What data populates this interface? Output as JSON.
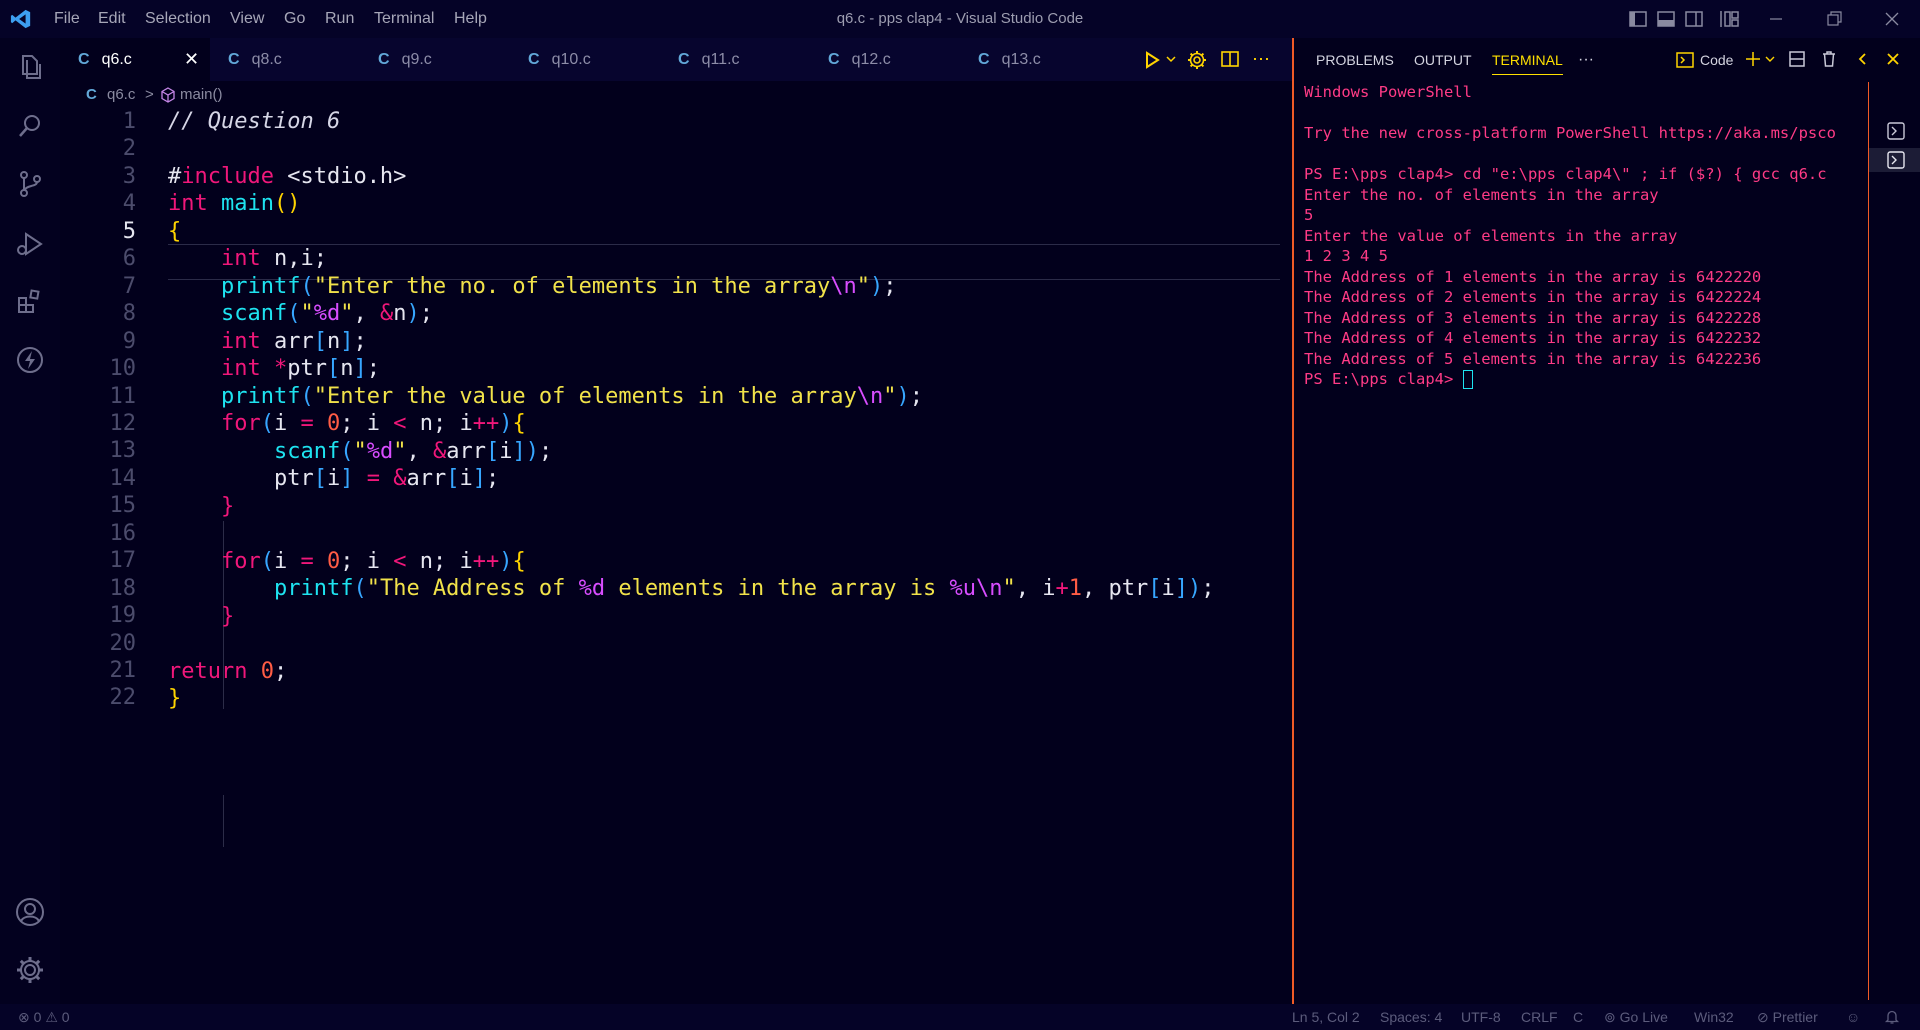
{
  "titlebar": {
    "window_title": "q6.c - pps clap4 - Visual Studio Code",
    "menu": [
      "File",
      "Edit",
      "Selection",
      "View",
      "Go",
      "Run",
      "Terminal",
      "Help"
    ]
  },
  "tabs": [
    {
      "label": "q6.c",
      "active": true
    },
    {
      "label": "q8.c"
    },
    {
      "label": "q9.c"
    },
    {
      "label": "q10.c"
    },
    {
      "label": "q11.c"
    },
    {
      "label": "q12.c"
    },
    {
      "label": "q13.c"
    }
  ],
  "tab_letter": "C",
  "breadcrumb": {
    "file": "q6.c",
    "separator": ">",
    "symbol": "main()"
  },
  "editor": {
    "current_line": 5,
    "line_numbers": [
      "1",
      "2",
      "3",
      "4",
      "5",
      "6",
      "7",
      "8",
      "9",
      "10",
      "11",
      "12",
      "13",
      "14",
      "15",
      "16",
      "17",
      "18",
      "19",
      "20",
      "21",
      "22"
    ]
  },
  "panel": {
    "tabs": [
      "PROBLEMS",
      "OUTPUT",
      "TERMINAL"
    ],
    "active_tab": "TERMINAL",
    "more": "···",
    "terminal_profile": "Code",
    "terminal_lines": [
      "Windows PowerShell",
      "",
      "Try the new cross-platform PowerShell https://aka.ms/psco",
      "",
      "PS E:\\pps clap4> cd \"e:\\pps clap4\\\" ; if ($?) { gcc q6.c",
      "Enter the no. of elements in the array",
      "5",
      "Enter the value of elements in the array",
      "1 2 3 4 5",
      "The Address of 1 elements in the array is 6422220",
      "The Address of 2 elements in the array is 6422224",
      "The Address of 3 elements in the array is 6422228",
      "The Address of 4 elements in the array is 6422232",
      "The Address of 5 elements in the array is 6422236",
      "PS E:\\pps clap4> "
    ]
  },
  "statusbar": {
    "errors": "0",
    "warnings": "0",
    "position": "Ln 5, Col 2",
    "spaces": "Spaces: 4",
    "encoding": "UTF-8",
    "eol": "CRLF",
    "language": "C",
    "go_live": "Go Live",
    "platform": "Win32",
    "prettier": "Prettier"
  },
  "colors": {
    "background": "#02001c",
    "accent": "#ffe000",
    "panel_border": "#f05a26",
    "terminal_text": "#ff3b86",
    "keyword": "#f0177a",
    "function": "#1ee3f0",
    "string": "#f1e24a"
  }
}
